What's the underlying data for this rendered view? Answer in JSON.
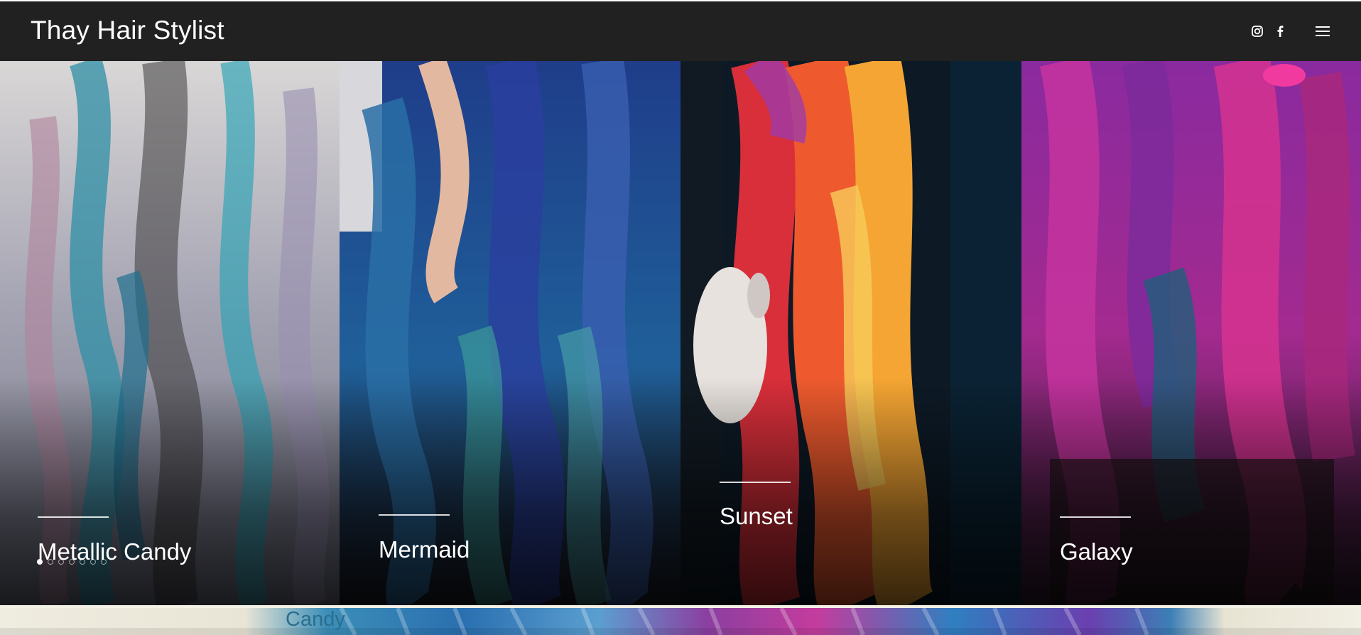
{
  "header": {
    "site_title": "Thay Hair Stylist",
    "icons": [
      "instagram-icon",
      "facebook-icon",
      "hamburger-menu-icon"
    ]
  },
  "gallery": {
    "panels": [
      {
        "caption": "Metallic Candy",
        "palette": [
          "#b8b9c4",
          "#2f8fa5",
          "#8a6a8f"
        ]
      },
      {
        "caption": "Mermaid",
        "palette": [
          "#1d3f8f",
          "#2a6fa6",
          "#3c9a9a"
        ]
      },
      {
        "caption": "Sunset",
        "palette": [
          "#e3352f",
          "#f08a2a",
          "#f2b84a"
        ]
      },
      {
        "caption": "Galaxy",
        "palette": [
          "#b52a9a",
          "#7d2a9b",
          "#d6338f"
        ]
      }
    ],
    "pager": {
      "total": 7,
      "active_index": 0
    }
  },
  "next_section": {
    "partial_title": "Candy"
  },
  "colors": {
    "header_bg": "#212121",
    "text": "#ffffff",
    "strip_label": "#2b6e8f"
  }
}
